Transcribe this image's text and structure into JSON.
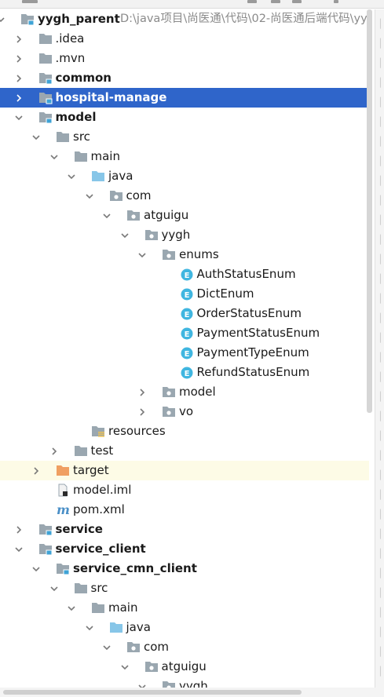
{
  "project": {
    "root_label": "yygh_parent",
    "root_path": "D:\\java项目\\尚医通\\代码\\02-尚医通后端代码\\yyg"
  },
  "tree": [
    {
      "id": "yygh_parent",
      "label": "yygh_parent",
      "level": 0,
      "arrow": "down",
      "icon": "module-folder-icon",
      "bold": true
    },
    {
      "id": "idea",
      "label": ".idea",
      "level": 1,
      "arrow": "right",
      "icon": "folder-icon"
    },
    {
      "id": "mvn",
      "label": ".mvn",
      "level": 1,
      "arrow": "right",
      "icon": "folder-icon"
    },
    {
      "id": "common",
      "label": "common",
      "level": 1,
      "arrow": "right",
      "icon": "module-folder-icon",
      "bold": true
    },
    {
      "id": "hospital-manage",
      "label": "hospital-manage",
      "level": 1,
      "arrow": "right",
      "icon": "module-folder-icon",
      "bold": true,
      "selected": true
    },
    {
      "id": "model",
      "label": "model",
      "level": 1,
      "arrow": "down",
      "icon": "module-folder-icon",
      "bold": true
    },
    {
      "id": "model-src",
      "label": "src",
      "level": 2,
      "arrow": "down",
      "icon": "folder-icon"
    },
    {
      "id": "model-main",
      "label": "main",
      "level": 3,
      "arrow": "down",
      "icon": "folder-icon"
    },
    {
      "id": "model-java",
      "label": "java",
      "level": 4,
      "arrow": "down",
      "icon": "source-folder-icon"
    },
    {
      "id": "model-com",
      "label": "com",
      "level": 5,
      "arrow": "down",
      "icon": "package-icon"
    },
    {
      "id": "model-atguigu",
      "label": "atguigu",
      "level": 6,
      "arrow": "down",
      "icon": "package-icon"
    },
    {
      "id": "model-yygh",
      "label": "yygh",
      "level": 7,
      "arrow": "down",
      "icon": "package-icon"
    },
    {
      "id": "enums",
      "label": "enums",
      "level": 8,
      "arrow": "down",
      "icon": "package-icon"
    },
    {
      "id": "AuthStatusEnum",
      "label": "AuthStatusEnum",
      "level": 9,
      "arrow": "none",
      "icon": "enum-icon"
    },
    {
      "id": "DictEnum",
      "label": "DictEnum",
      "level": 9,
      "arrow": "none",
      "icon": "enum-icon"
    },
    {
      "id": "OrderStatusEnum",
      "label": "OrderStatusEnum",
      "level": 9,
      "arrow": "none",
      "icon": "enum-icon"
    },
    {
      "id": "PaymentStatusEnum",
      "label": "PaymentStatusEnum",
      "level": 9,
      "arrow": "none",
      "icon": "enum-icon"
    },
    {
      "id": "PaymentTypeEnum",
      "label": "PaymentTypeEnum",
      "level": 9,
      "arrow": "none",
      "icon": "enum-icon"
    },
    {
      "id": "RefundStatusEnum",
      "label": "RefundStatusEnum",
      "level": 9,
      "arrow": "none",
      "icon": "enum-icon"
    },
    {
      "id": "model-pkg",
      "label": "model",
      "level": 8,
      "arrow": "right",
      "icon": "package-icon"
    },
    {
      "id": "vo",
      "label": "vo",
      "level": 8,
      "arrow": "right",
      "icon": "package-icon"
    },
    {
      "id": "resources",
      "label": "resources",
      "level": 4,
      "arrow": "none",
      "icon": "resources-folder-icon"
    },
    {
      "id": "model-test",
      "label": "test",
      "level": 3,
      "arrow": "right",
      "icon": "folder-icon"
    },
    {
      "id": "target",
      "label": "target",
      "level": 2,
      "arrow": "right",
      "icon": "excluded-folder-icon",
      "excluded": true
    },
    {
      "id": "model-iml",
      "label": "model.iml",
      "level": 2,
      "arrow": "none",
      "icon": "iml-file-icon"
    },
    {
      "id": "pom",
      "label": "pom.xml",
      "level": 2,
      "arrow": "none",
      "icon": "maven-file-icon"
    },
    {
      "id": "service",
      "label": "service",
      "level": 1,
      "arrow": "right",
      "icon": "module-folder-icon",
      "bold": true
    },
    {
      "id": "service_client",
      "label": "service_client",
      "level": 1,
      "arrow": "down",
      "icon": "module-folder-icon",
      "bold": true
    },
    {
      "id": "service_cmn_client",
      "label": "service_cmn_client",
      "level": 2,
      "arrow": "down",
      "icon": "module-folder-icon",
      "bold": true
    },
    {
      "id": "scc-src",
      "label": "src",
      "level": 3,
      "arrow": "down",
      "icon": "folder-icon"
    },
    {
      "id": "scc-main",
      "label": "main",
      "level": 4,
      "arrow": "down",
      "icon": "folder-icon"
    },
    {
      "id": "scc-java",
      "label": "java",
      "level": 5,
      "arrow": "down",
      "icon": "source-folder-icon"
    },
    {
      "id": "scc-com",
      "label": "com",
      "level": 6,
      "arrow": "down",
      "icon": "package-icon"
    },
    {
      "id": "scc-atguigu",
      "label": "atguigu",
      "level": 7,
      "arrow": "down",
      "icon": "package-icon"
    },
    {
      "id": "scc-yygh",
      "label": "yygh",
      "level": 8,
      "arrow": "down",
      "icon": "package-icon"
    }
  ],
  "colors": {
    "selection": "#2f65ca",
    "excluded_row": "#fdfbe6",
    "folder": "#9aa7b0",
    "source_folder": "#87c6e8",
    "excluded_folder": "#f09f61",
    "enum_badge": "#40b6e0",
    "module_marker": "#3fa3d6"
  }
}
